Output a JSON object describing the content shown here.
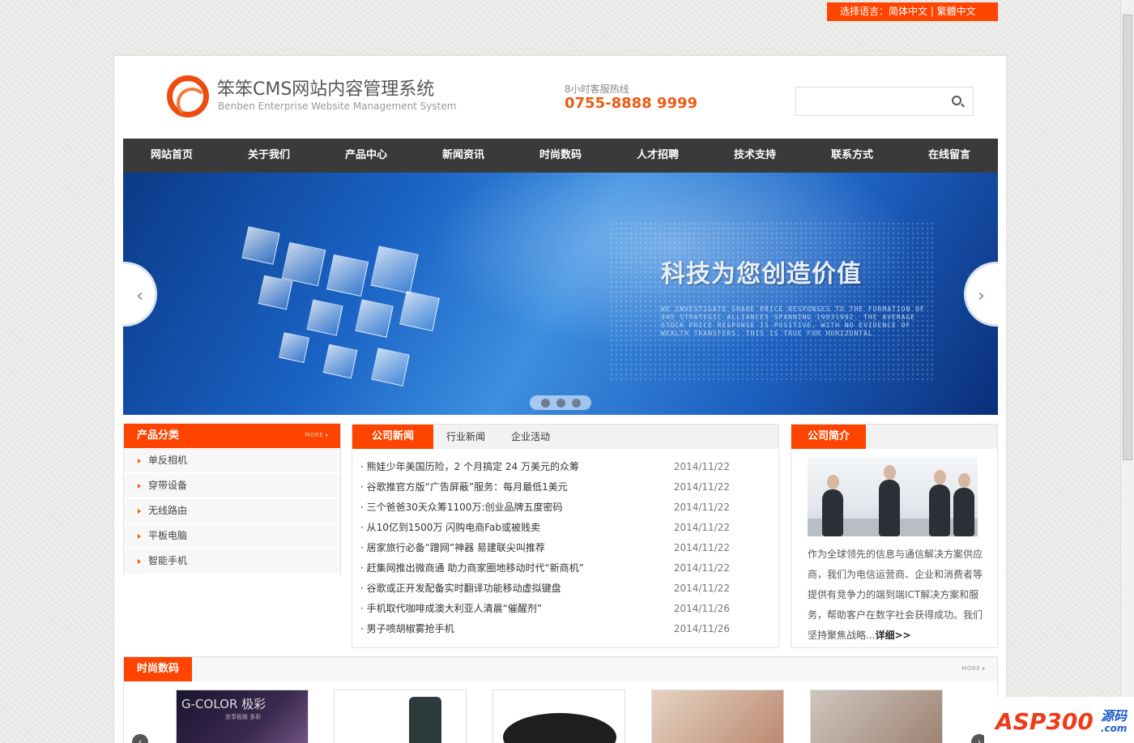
{
  "language_bar": {
    "text": "选择语言：简体中文 | 繁體中文"
  },
  "header": {
    "logo_title": "笨笨CMS网站内容管理系统",
    "logo_subtitle": "Benben Enterprise Website Management System",
    "hotline_label": "8小时客服热线",
    "hotline_number": "0755-8888 9999",
    "search_placeholder": ""
  },
  "nav": [
    "网站首页",
    "关于我们",
    "产品中心",
    "新闻资讯",
    "时尚数码",
    "人才招聘",
    "技术支持",
    "联系方式",
    "在线留言"
  ],
  "banner": {
    "title": "科技为您创造价值",
    "subtitle": "WE INVESTIGATE SHARE PRICE RESPONSES TO THE FORMATION OF 345 STRATEGIC ALLIANCES SPANNING 19831992. THE AVERAGE STOCK PRICE RESPONSE IS POSITIVE, WITH NO EVIDENCE OF WEALTH TRANSFERS. THIS IS TRUE FOR HORIZONTAL",
    "prev_icon": "‹",
    "next_icon": "›"
  },
  "categories": {
    "title": "产品分类",
    "more": "MORE ▸",
    "items": [
      "单反相机",
      "穿带设备",
      "无线路由",
      "平板电脑",
      "智能手机"
    ]
  },
  "news": {
    "tabs": [
      "公司新闻",
      "行业新闻",
      "企业活动"
    ],
    "items": [
      {
        "title": "· 熊娃少年美国历险，2 个月搞定 24 万美元的众筹",
        "date": "2014/11/22"
      },
      {
        "title": "· 谷歌推官方版“广告屏蔽”服务：每月最低1美元",
        "date": "2014/11/22"
      },
      {
        "title": "· 三个爸爸30天众筹1100万:创业品牌五度密码",
        "date": "2014/11/22"
      },
      {
        "title": "· 从10亿到1500万 闪购电商Fab或被贱卖",
        "date": "2014/11/22"
      },
      {
        "title": "· 居家旅行必备“蹭网”神器 易建联尖叫推荐",
        "date": "2014/11/22"
      },
      {
        "title": "· 赶集网推出微商通 助力商家圈地移动时代“新商机”",
        "date": "2014/11/22"
      },
      {
        "title": "· 谷歌或正开发配备实时翻译功能移动虚拟键盘",
        "date": "2014/11/22"
      },
      {
        "title": "· 手机取代咖啡成澳大利亚人清晨“催醒剂”",
        "date": "2014/11/26"
      },
      {
        "title": "· 男子喷胡椒雾抢手机",
        "date": "2014/11/26"
      }
    ]
  },
  "intro": {
    "title": "公司简介",
    "text": "作为全球领先的信息与通信解决方案供应商，我们为电信运营商、企业和消费者等提供有竞争力的端到端ICT解决方案和服务，帮助客户在数字社会获得成功。我们坚持聚焦战略...",
    "link": "详细>>"
  },
  "fashion": {
    "title": "时尚数码",
    "more": "MORE ▸",
    "thumb1_text": "G-COLOR 极彩",
    "thumb1_sub": "坐享极致 多彩"
  },
  "watermark": {
    "brand": "ASP300",
    "suffix": "源码",
    "domain": ".com"
  },
  "colors": {
    "accent": "#ff4400",
    "nav_bg": "#3a3a3a",
    "hotline": "#ee5a10"
  }
}
